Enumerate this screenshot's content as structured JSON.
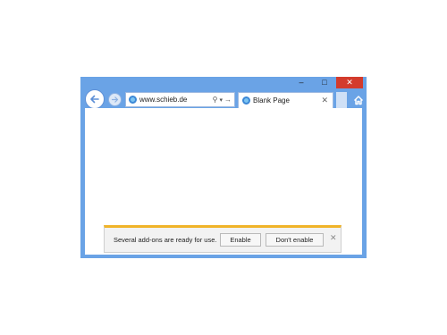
{
  "window": {
    "controls": {
      "minimize_glyph": "–",
      "maximize_glyph": "□",
      "close_glyph": "✕"
    }
  },
  "nav": {
    "back_icon": "arrow-left-icon",
    "forward_icon": "arrow-right-icon"
  },
  "address_bar": {
    "url": "www.schieb.de",
    "search_glyph": "⚲",
    "dropdown_glyph": "▾",
    "go_glyph": "→"
  },
  "tab": {
    "title": "Blank Page",
    "close_glyph": "✕"
  },
  "notification": {
    "message": "Several add-ons are ready for use.",
    "enable_label": "Enable",
    "dont_enable_label": "Don't enable",
    "close_glyph": "✕"
  },
  "colors": {
    "frame": "#6aa3e6",
    "close_button": "#d33b2c",
    "notification_accent": "#f0b429"
  }
}
